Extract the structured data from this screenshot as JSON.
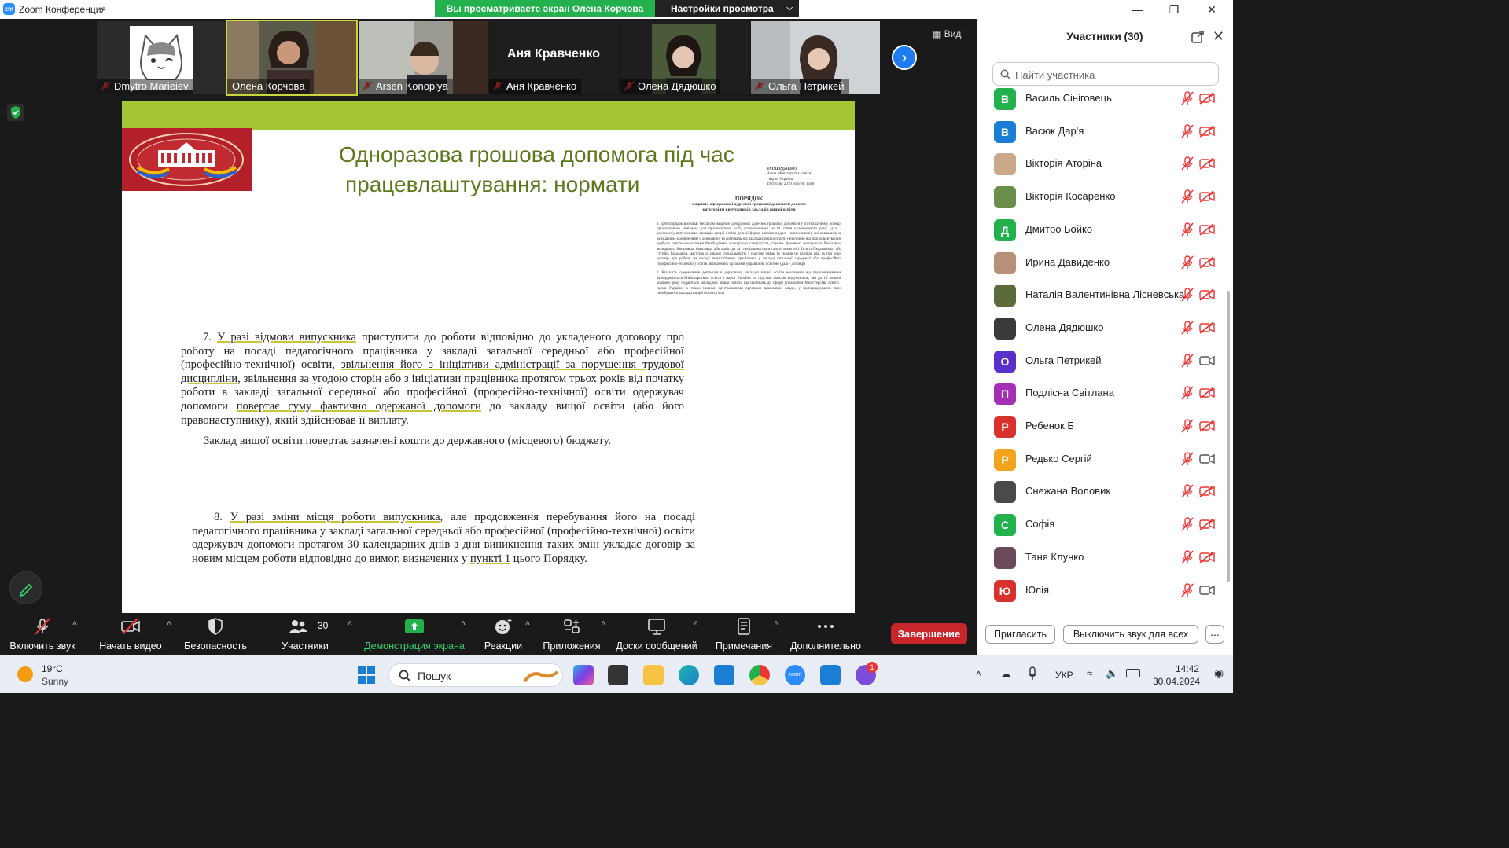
{
  "window": {
    "title": "Zoom Конференция",
    "logo": "zm",
    "sharing_banner": "Вы просматриваете экран Олена Корчова",
    "view_settings": "Настройки просмотра"
  },
  "tiles": [
    {
      "name": "Dmytro Marieiev",
      "muted": true
    },
    {
      "name": "Олена Корчова",
      "muted": false,
      "active": true
    },
    {
      "name": "Arsen Konoplya",
      "muted": true
    },
    {
      "name": "Аня Кравченко",
      "muted": true,
      "big_name": "Аня Кравченко"
    },
    {
      "name": "Олена Дядюшко",
      "muted": true
    },
    {
      "name": "Ольга Петрикей",
      "muted": true
    }
  ],
  "view_button": "Вид",
  "slide": {
    "title_line1": "Одноразова грошова допомога під час",
    "title_line2": "працевлаштування: нормати",
    "doc": {
      "approved": "ЗАТВЕРДЖЕНО",
      "approved_by": "Наказ Міністерства освіти",
      "approved_by2": "і науки України",
      "approved_date": "19 грудня 2019 року № 1588",
      "heading": "ПОРЯДОК",
      "sub1": "надання одноразової адресної грошової допомоги деяким",
      "sub2": "категоріям випускників закладів вищої освіти",
      "p1": "1. Цей Порядок визначає механізм надання одноразової адресної грошової допомоги у п'ятикратному розмірі прожиткового мінімуму для працездатних осіб, установленого на 01 січня календарного року (далі - допомога), випускникам закладів вищої освіти денної форми навчання (далі - випускники), які навчались за державним замовленням у державних та комунальних закладах вищої освіти незалежно від підпорядкування, здобули освітньо-кваліфікаційний рівень молодшого спеціаліста, ступінь фахового молодшого бакалавра, молодшого бакалавра, бакалавра або магістра за спеціальностями галузі знань «01 Освіта/Педагогіка», або ступінь бакалавра, магістра за іншою спеціальністю і галуззю знань та уклали не пізніше ніж за три роки договір про роботу на посаді педагогічного працівника у закладі загальної середньої або професійної (професійно-технічної) освіти, визначених органами управління освітою (далі - договір)",
      "p2": "2. Кількість одержувачів допомоги в державних закладах вищої освіти незалежно від підпорядкування затверджується Міністерством освіти і науки України на підставі списків випускників, які до 15 жовтня кожного року подаються закладами вищої освіти, що належать до сфери управління Міністерства освіти і науки України, а також іншими центральними органами виконавчої влади, у підпорядкуванні яких перебувають заклади вищої освіти, поля"
    },
    "p7_num": "7.",
    "p7_u1": "У разі відмови випускника",
    "p7_t1": " приступити до роботи відповідно до укладеного договору про роботу на посаді педагогічного працівника у закладі загальної середньої або професійної (професійно-технічної) освіти, ",
    "p7_u2": "звільнення його з ініціативи адміністрації за порушення трудової дисципліни",
    "p7_t2": ", звільнення за угодою сторін або з ініціативи працівника протягом трьох років від початку роботи в закладі загальної середньої або професійної (професійно-технічної) освіти одержувач допомоги ",
    "p7_u3": "повертає суму фактично одержаної допомоги",
    "p7_t3": " до закладу вищої освіти (або його правонаступнику), який здійснював її виплату.",
    "p7b": "Заклад вищої освіти повертає зазначені кошти до державного (місцевого) бюджету.",
    "p8_num": "8.",
    "p8_u1": "У разі зміни місця роботи випускника",
    "p8_t1": ", але продовження перебування його на посаді педагогічного працівника у закладі загальної середньої або професійної (професійно-технічної) освіти одержувач допомоги протягом 30 календарних днів з дня виникнення таких змін укладає договір за новим місцем роботи відповідно до вимог, визначених у ",
    "p8_u2": "пункті 1",
    "p8_t2": " цього Порядку."
  },
  "toolbar": {
    "unmute": "Включить звук",
    "start_video": "Начать видео",
    "security": "Безопасность",
    "participants": "Участники",
    "participants_count": "30",
    "share": "Демонстрация экрана",
    "reactions": "Реакции",
    "apps": "Приложения",
    "whiteboards": "Доски сообщений",
    "notes": "Примечания",
    "more": "Дополнительно",
    "end": "Завершение"
  },
  "panel": {
    "title": "Участники (30)",
    "search_placeholder": "Найти участника",
    "participants": [
      {
        "initial": "В",
        "name": "Василь Сініговець",
        "color": "#23b14d",
        "video": false
      },
      {
        "initial": "В",
        "name": "Васюк Дар'я",
        "color": "#1a7fd4",
        "video": false
      },
      {
        "initial": "",
        "name": "Вікторія Аторіна",
        "color": "#c9a98a",
        "video": false
      },
      {
        "initial": "",
        "name": "Вікторія Косаренко",
        "color": "#6b8f4b",
        "video": false
      },
      {
        "initial": "Д",
        "name": "Дмитро Бойко",
        "color": "#23b14d",
        "video": false
      },
      {
        "initial": "",
        "name": "Ирина Давиденко",
        "color": "#b89078",
        "video": false
      },
      {
        "initial": "",
        "name": "Наталія Валентинівна Лісневська",
        "color": "#5b6b3a",
        "video": false
      },
      {
        "initial": "",
        "name": "Олена Дядюшко",
        "color": "#3a3a3a",
        "video": false
      },
      {
        "initial": "О",
        "name": "Ольга Петрикей",
        "color": "#5b2fc9",
        "video": true
      },
      {
        "initial": "П",
        "name": "Подлісна Світлана",
        "color": "#a52fb3",
        "video": false
      },
      {
        "initial": "Р",
        "name": "Ребенок.Б",
        "color": "#d9322e",
        "video": false
      },
      {
        "initial": "Р",
        "name": "Редько Сергій",
        "color": "#f2a41c",
        "video": true
      },
      {
        "initial": "",
        "name": "Снежана Воловик",
        "color": "#4a4a4a",
        "video": false
      },
      {
        "initial": "С",
        "name": "Софія",
        "color": "#23b14d",
        "video": false
      },
      {
        "initial": "",
        "name": "Таня Клунко",
        "color": "#6a4a5a",
        "video": false
      },
      {
        "initial": "Ю",
        "name": "Юлія",
        "color": "#d9322e",
        "video": true
      }
    ],
    "invite": "Пригласить",
    "mute_all": "Выключить звук для всех",
    "more": "..."
  },
  "taskbar": {
    "temp": "19°C",
    "weather": "Sunny",
    "search": "Пошук",
    "lang": "УКР",
    "time": "14:42",
    "date": "30.04.2024",
    "notification_badge": "1"
  }
}
